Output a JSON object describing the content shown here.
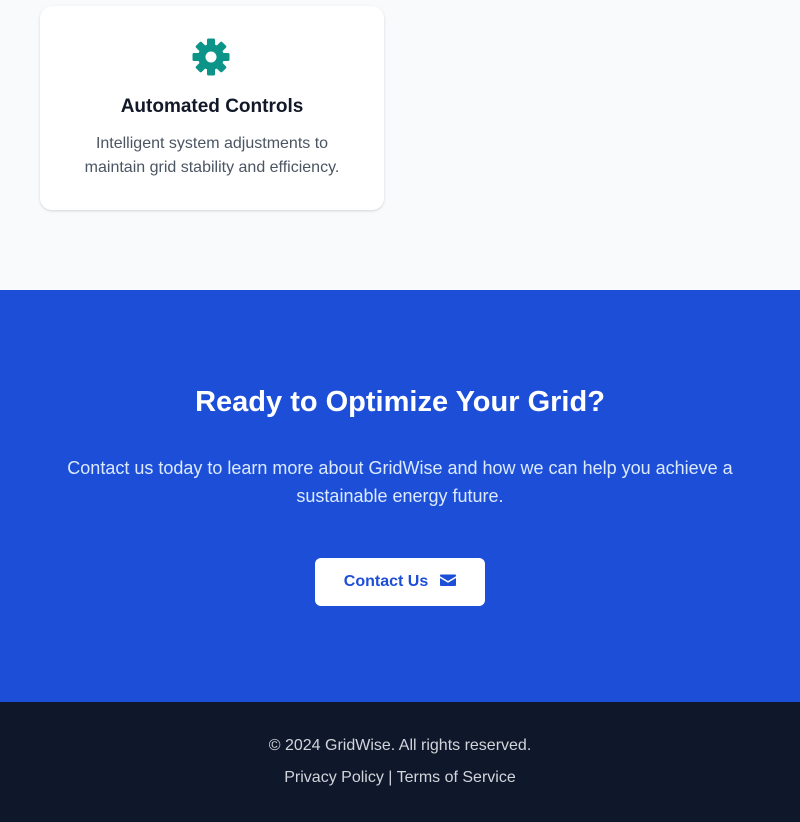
{
  "colors": {
    "page_bg": "#f8fafc",
    "card_bg": "#ffffff",
    "accent_teal": "#0d9488",
    "cta_bg": "#1d4ed8",
    "footer_bg": "#0f172a",
    "button_text": "#1d4ed8"
  },
  "feature_card": {
    "icon": "gear-icon",
    "title": "Automated Controls",
    "description": "Intelligent system adjustments to maintain grid stability and efficiency."
  },
  "cta": {
    "heading": "Ready to Optimize Your Grid?",
    "text": "Contact us today to learn more about GridWise and how we can help you achieve a sustainable energy future.",
    "button_label": "Contact Us",
    "button_icon": "envelope-icon"
  },
  "footer": {
    "copyright": "© 2024 GridWise. All rights reserved.",
    "privacy_label": "Privacy Policy",
    "separator": "|",
    "terms_label": "Terms of Service"
  }
}
